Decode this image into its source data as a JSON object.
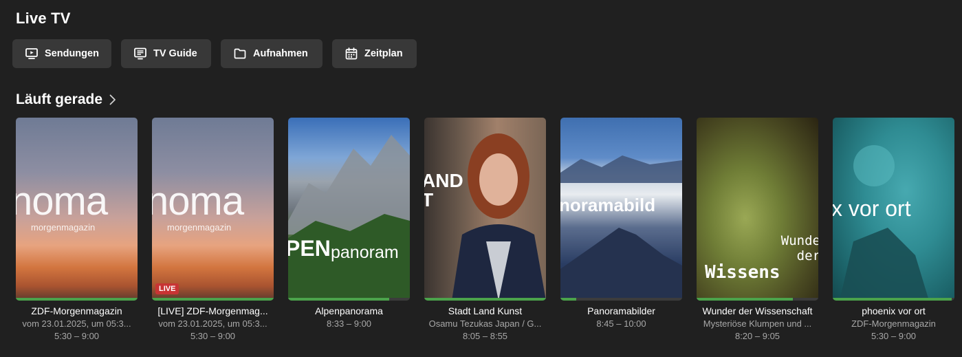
{
  "page": {
    "title": "Live TV"
  },
  "nav": [
    {
      "label": "Sendungen",
      "icon": "tv-play-icon"
    },
    {
      "label": "TV Guide",
      "icon": "tv-guide-icon"
    },
    {
      "label": "Aufnahmen",
      "icon": "folder-icon"
    },
    {
      "label": "Zeitplan",
      "icon": "calendar-icon"
    }
  ],
  "section": {
    "title": "Läuft gerade",
    "icon": "chevron-right-icon"
  },
  "cards": [
    {
      "title": "ZDF-Morgenmagazin",
      "subtitle": "vom 23.01.2025, um 05:3...",
      "time": "5:30 – 9:00",
      "progress": 1.0,
      "live": false,
      "art_big": "noma",
      "art_small": "morgenmagazin"
    },
    {
      "title": "[LIVE] ZDF-Morgenmag...",
      "subtitle": "vom 23.01.2025, um 05:3...",
      "time": "5:30 – 9:00",
      "progress": 1.0,
      "live": true,
      "live_label": "LIVE",
      "art_big": "noma",
      "art_small": "morgenmagazin"
    },
    {
      "title": "Alpenpanorama",
      "subtitle": "",
      "time": "8:33 – 9:00",
      "progress": 0.83,
      "live": false,
      "art_big": "PEN",
      "art_small": "panoram"
    },
    {
      "title": "Stadt Land Kunst",
      "subtitle": "Osamu Tezukas Japan / G...",
      "time": "8:05 – 8:55",
      "progress": 1.0,
      "live": false,
      "art_big": "AND",
      "art_small": "T"
    },
    {
      "title": "Panoramabilder",
      "subtitle": "",
      "time": "8:45 – 10:00",
      "progress": 0.13,
      "live": false,
      "art_big": "noramabild",
      "art_small": ""
    },
    {
      "title": "Wunder der Wissenschaft",
      "subtitle": "Mysteriöse Klumpen und ...",
      "time": "8:20 – 9:05",
      "progress": 0.79,
      "live": false,
      "art_big": "Wissens",
      "art_small": "Wunde der"
    },
    {
      "title": "phoenix vor ort",
      "subtitle": "ZDF-Morgenmagazin",
      "time": "5:30 – 9:00",
      "progress": 0.98,
      "live": false,
      "art_big": "x vor ort",
      "art_small": ""
    }
  ],
  "colors": {
    "background": "#202020",
    "button": "#383838",
    "progress": "#4ba34b",
    "live": "#c83434",
    "muted": "#a8a8a8"
  }
}
